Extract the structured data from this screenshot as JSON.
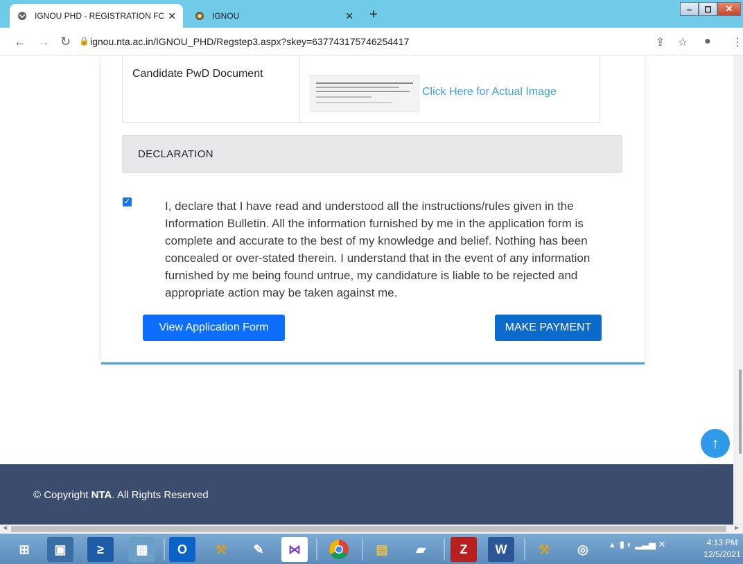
{
  "browser": {
    "tabs": [
      {
        "title": "IGNOU PHD - REGISTRATION FO",
        "active": true
      },
      {
        "title": "IGNOU",
        "active": false
      }
    ],
    "new_tab": "+",
    "url": "ignou.nta.ac.in/IGNOU_PHD/Regstep3.aspx?skey=637743175746254417"
  },
  "page": {
    "document": {
      "label": "Candidate PwD Document",
      "link": "Click Here for Actual Image"
    },
    "declaration": {
      "heading": "DECLARATION",
      "checked": true,
      "text": "I, declare that I have read and understood all the instructions/rules given in the Information Bulletin. All the information furnished by me in the application form is complete and accurate to the best of my knowledge and belief. Nothing has been concealed or over-stated therein. I understand that in the event of any information furnished by me being found untrue, my candidature is liable to be rejected and appropriate action may be taken against me."
    },
    "buttons": {
      "view": "View Application Form",
      "pay": "MAKE PAYMENT"
    },
    "footer": {
      "copyright_prefix": "© Copyright ",
      "brand": "NTA",
      "copyright_suffix": ". All Rights Reserved"
    }
  },
  "taskbar": {
    "time": "4:13 PM",
    "date": "12/5/2021"
  },
  "colors": {
    "titlebar": "#6fcbe8",
    "primary_button": "#0d6efd",
    "footer": "#3c4c6e",
    "link": "#3ea0d6"
  }
}
